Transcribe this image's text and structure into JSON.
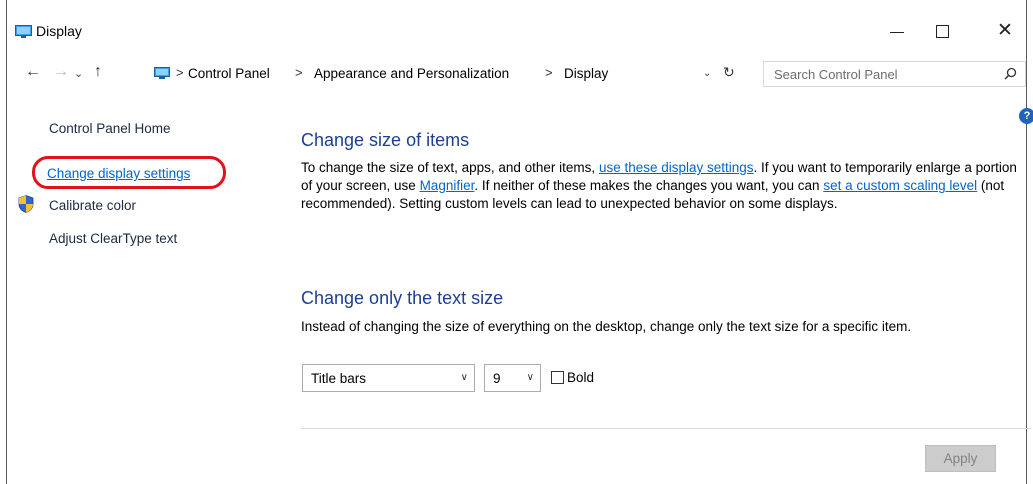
{
  "window": {
    "title": "Display",
    "icon": "display-monitor-icon",
    "controls": {
      "minimize": "minimize-icon",
      "maximize": "maximize-icon",
      "close": "✕"
    }
  },
  "nav": {
    "back": "←",
    "forward": "→",
    "recent": "⌄",
    "up": "↑",
    "breadcrumb": [
      "Control Panel",
      "Appearance and Personalization",
      "Display"
    ],
    "separator": ">",
    "dropdown": "⌄",
    "refresh": "↻",
    "search_placeholder": "Search Control Panel"
  },
  "sidebar": {
    "home": "Control Panel Home",
    "display_settings": "Change display settings",
    "calibrate": "Calibrate color",
    "cleartype": "Adjust ClearType text"
  },
  "help": {
    "label": "?"
  },
  "main": {
    "section1": {
      "title": "Change size of items",
      "text_a": "To change the size of text, apps, and other items, ",
      "link_a": "use these display settings",
      "text_b": ".  If you want to temporarily enlarge a portion of your screen, use ",
      "link_b": "Magnifier",
      "text_c": ".  If neither of these makes the changes you want, you can ",
      "link_c": "set a custom scaling level",
      "text_d": " (not recommended).  Setting custom levels can lead to unexpected behavior on some displays."
    },
    "section2": {
      "title": "Change only the text size",
      "description": "Instead of changing the size of everything on the desktop, change only the text size for a specific item.",
      "element_select": "Title bars",
      "size_select": "9",
      "bold_label": "Bold",
      "bold_checked": false
    },
    "apply": "Apply"
  },
  "colors": {
    "heading": "#1c3f94",
    "link": "#0066cc",
    "highlight_ring": "#e0131c",
    "disabled_button": "#cccccc"
  }
}
